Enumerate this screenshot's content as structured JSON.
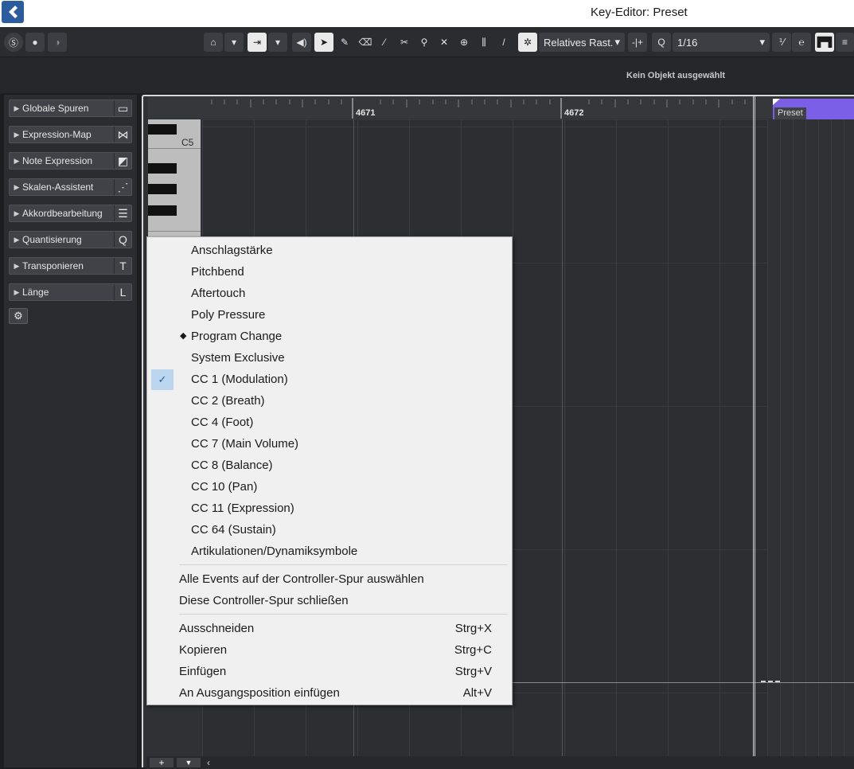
{
  "window": {
    "title": "Key-Editor: Preset"
  },
  "toolbar": {
    "grid_type": "Relatives Rast.",
    "quantize_value": "1/16",
    "quantize_label": "Q"
  },
  "infoline": {
    "text": "Kein Objekt ausgewählt"
  },
  "left_zone": {
    "sections": [
      {
        "label": "Globale Spuren",
        "icon": "▭"
      },
      {
        "label": "Expression-Map",
        "icon": "⋈"
      },
      {
        "label": "Note Expression",
        "icon": "◩"
      },
      {
        "label": "Skalen-Assistent",
        "icon": "⋰"
      },
      {
        "label": "Akkordbearbeitung",
        "icon": "☰"
      },
      {
        "label": "Quantisierung",
        "icon": "Q"
      },
      {
        "label": "Transponieren",
        "icon": "T"
      },
      {
        "label": "Länge",
        "icon": "L"
      }
    ]
  },
  "ruler": {
    "bar_1": "4671",
    "bar_2": "4672",
    "part_name": "Preset"
  },
  "keyboard": {
    "c5_label": "C5"
  },
  "context_menu": {
    "controller_items": [
      {
        "label": "Anschlagstärke",
        "state": ""
      },
      {
        "label": "Pitchbend",
        "state": ""
      },
      {
        "label": "Aftertouch",
        "state": ""
      },
      {
        "label": "Poly Pressure",
        "state": ""
      },
      {
        "label": "Program Change",
        "state": "bullet"
      },
      {
        "label": "System Exclusive",
        "state": ""
      },
      {
        "label": "CC 1  (Modulation)",
        "state": "checked"
      },
      {
        "label": "CC 2  (Breath)",
        "state": ""
      },
      {
        "label": "CC 4  (Foot)",
        "state": ""
      },
      {
        "label": "CC 7  (Main Volume)",
        "state": ""
      },
      {
        "label": "CC 8  (Balance)",
        "state": ""
      },
      {
        "label": "CC 10  (Pan)",
        "state": ""
      },
      {
        "label": "CC 11  (Expression)",
        "state": ""
      },
      {
        "label": "CC 64  (Sustain)",
        "state": ""
      },
      {
        "label": "Artikulationen/Dynamiksymbole",
        "state": ""
      }
    ],
    "lane_items": [
      {
        "label": "Alle Events auf der Controller-Spur auswählen"
      },
      {
        "label": "Diese Controller-Spur schließen"
      }
    ],
    "edit_items": [
      {
        "label": "Ausschneiden",
        "shortcut": "Strg+X"
      },
      {
        "label": "Kopieren",
        "shortcut": "Strg+C"
      },
      {
        "label": "Einfügen",
        "shortcut": "Strg+V"
      },
      {
        "label": "An Ausgangsposition einfügen",
        "shortcut": "Alt+V"
      }
    ]
  }
}
